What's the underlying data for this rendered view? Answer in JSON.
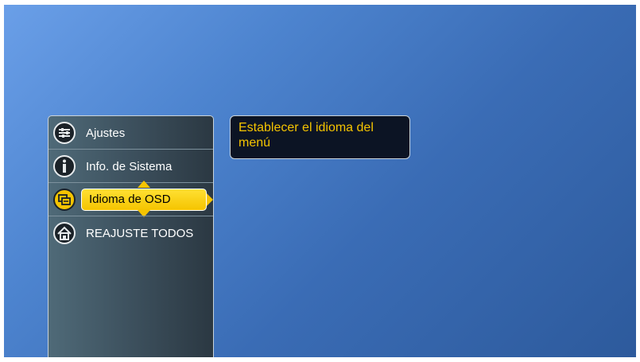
{
  "menu": {
    "items": [
      {
        "label": "Ajustes",
        "icon": "sliders-icon"
      },
      {
        "label": "Info. de Sistema",
        "icon": "info-icon"
      },
      {
        "label": "Idioma de OSD",
        "icon": "language-icon",
        "selected": true
      },
      {
        "label": "REAJUSTE TODOS",
        "icon": "home-icon"
      }
    ]
  },
  "tooltip": {
    "text": "Establecer el idioma del menú"
  },
  "colors": {
    "highlight": "#f5c400",
    "tooltip_text": "#f5c400",
    "panel": "#3b4e5b",
    "background": "#4d84cf"
  }
}
